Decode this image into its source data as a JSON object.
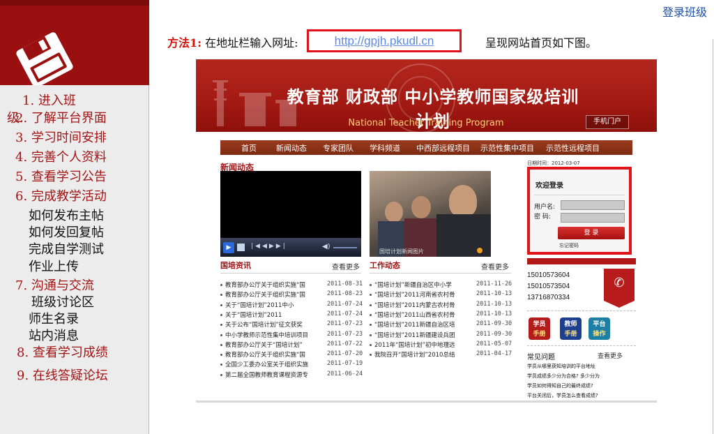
{
  "login_link": "登录班级",
  "sidebar": {
    "items": [
      {
        "label": "1. 进入班",
        "kind": "main"
      },
      {
        "label": "级.",
        "kind": "main"
      },
      {
        "label": "2. 了解平台界面",
        "kind": "main"
      },
      {
        "label": "3. 学习时间安排",
        "kind": "main"
      },
      {
        "label": "4. 完善个人资料",
        "kind": "main"
      },
      {
        "label": "5. 查看学习公告",
        "kind": "main"
      },
      {
        "label": "6. 完成教学活动",
        "kind": "main"
      },
      {
        "label": "如何发布主帖",
        "kind": "sub"
      },
      {
        "label": "如何发回复帖",
        "kind": "sub"
      },
      {
        "label": "完成自学测试",
        "kind": "sub"
      },
      {
        "label": "作业上传",
        "kind": "sub"
      },
      {
        "label": "7. 沟通与交流",
        "kind": "main"
      },
      {
        "label": "班级讨论区",
        "kind": "sub"
      },
      {
        "label": "师生名录",
        "kind": "sub"
      },
      {
        "label": "站内消息",
        "kind": "sub"
      },
      {
        "label": "8. 查看学习成绩",
        "kind": "main"
      },
      {
        "label": "9. 在线答疑论坛",
        "kind": "main"
      }
    ]
  },
  "instruction": {
    "method_label": "方法1:",
    "text_before": "在地址栏输入网址:",
    "url": "http://gpjh.pkudl.cn",
    "text_after": "呈现网站首页如下图。"
  },
  "site": {
    "title": "教育部  财政部  中小学教师国家级培训计划",
    "subtitle": "National Teacher Training Program",
    "mobile_button": "手机门户",
    "nav": [
      "首页",
      "新闻动态",
      "专家团队",
      "学科频道",
      "中西部远程项目",
      "示范性集中项目",
      "示范性远程项目"
    ],
    "news_title": "新闻动态",
    "photo_caption": "国培计划新闻图片",
    "col1": {
      "heading": "国培资讯",
      "more": "查看更多",
      "rows": [
        {
          "text": "教育部办公厅关于组织实施“国",
          "date": "2011-08-31"
        },
        {
          "text": "教育部办公厅关于组织实施“国",
          "date": "2011-08-23"
        },
        {
          "text": "关于“国培计划”2011中小",
          "date": "2011-07-24"
        },
        {
          "text": "关于“国培计划”2011",
          "date": "2011-07-24"
        },
        {
          "text": "关于公布“国培计划”征文获奖",
          "date": "2011-07-23"
        },
        {
          "text": "中小学教师示范性集中培训项目",
          "date": "2011-07-23"
        },
        {
          "text": "教育部办公厅关于“国培计划”",
          "date": "2011-07-22"
        },
        {
          "text": "教育部办公厅关于组织实施“国",
          "date": "2011-07-20"
        },
        {
          "text": "全国少工委办公室关于组织实施",
          "date": "2011-07-19"
        },
        {
          "text": "第二届全国教师教育课程资源专",
          "date": "2011-06-24"
        }
      ]
    },
    "col2": {
      "heading": "工作动态",
      "more": "查看更多",
      "rows": [
        {
          "text": "“国培计划”新疆自治区中小学",
          "date": "2011-11-26"
        },
        {
          "text": "“国培计划”2011河南省农村骨",
          "date": "2011-10-13"
        },
        {
          "text": "“国培计划”2011内蒙古农村骨",
          "date": "2011-10-13"
        },
        {
          "text": "“国培计划”2011山西省农村骨",
          "date": "2011-10-13"
        },
        {
          "text": "“国培计划”2011新疆自治区培",
          "date": "2011-09-30"
        },
        {
          "text": "“国培计划”2011新疆建设兵团",
          "date": "2011-09-30"
        },
        {
          "text": "2011年“国培计划”初中地理远",
          "date": "2011-05-07"
        },
        {
          "text": "我院召开“国培计划”2010总结",
          "date": "2011-04-17"
        }
      ]
    },
    "date_line": "日期时间：2012-03-07",
    "login": {
      "welcome": "欢迎登录",
      "username_label": "用户名:",
      "password_label": "密  码:",
      "button": "登  录",
      "forgot": "忘记密码"
    },
    "phones": [
      "15010573604",
      "15010573504",
      "13716870334"
    ],
    "manual_buttons": [
      {
        "line1": "学员",
        "line2": "手册",
        "color": "#b41b1b"
      },
      {
        "line1": "教师",
        "line2": "手册",
        "color": "#1d3f8f"
      },
      {
        "line1": "平台",
        "line2": "操作",
        "color": "#1c7fa3"
      }
    ],
    "faq": {
      "title": "常见问题",
      "more": "查看更多",
      "items": [
        "学员从哪里获知培训的平台地址",
        "学员成绩多少分为合格? 多少分为",
        "学员如何得知自己的最终成绩?",
        "平台关闭后，学员怎么查看成绩?"
      ]
    }
  }
}
